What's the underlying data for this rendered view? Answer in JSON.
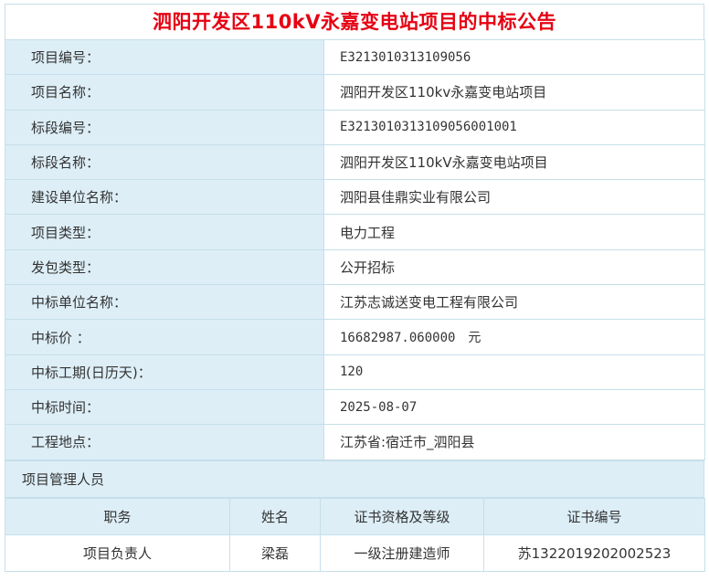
{
  "title": "泗阳开发区110kV永嘉变电站项目的中标公告",
  "fields": [
    {
      "label": "项目编号：",
      "value": "E3213010313109056"
    },
    {
      "label": "项目名称：",
      "value": "泗阳开发区110kv永嘉变电站项目"
    },
    {
      "label": "标段编号：",
      "value": "E3213010313109056001001"
    },
    {
      "label": "标段名称：",
      "value": "泗阳开发区110kV永嘉变电站项目"
    },
    {
      "label": "建设单位名称：",
      "value": "泗阳县佳鼎实业有限公司"
    },
    {
      "label": "项目类型：",
      "value": "电力工程"
    },
    {
      "label": "发包类型：",
      "value": "公开招标"
    },
    {
      "label": "中标单位名称：",
      "value": "江苏志诚送变电工程有限公司"
    },
    {
      "label": "中标价 ：",
      "value": "16682987.060000　元"
    },
    {
      "label": "中标工期(日历天)：",
      "value": "120"
    },
    {
      "label": "中标时间：",
      "value": "2025-08-07"
    },
    {
      "label": "工程地点：",
      "value": "江苏省:宿迁市_泗阳县"
    }
  ],
  "staff_section": "项目管理人员",
  "staff_headers": [
    "职务",
    "姓名",
    "证书资格及等级",
    "证书编号"
  ],
  "staff_rows": [
    [
      "项目负责人",
      "梁磊",
      "一级注册建造师",
      "苏1322019202002523"
    ]
  ]
}
